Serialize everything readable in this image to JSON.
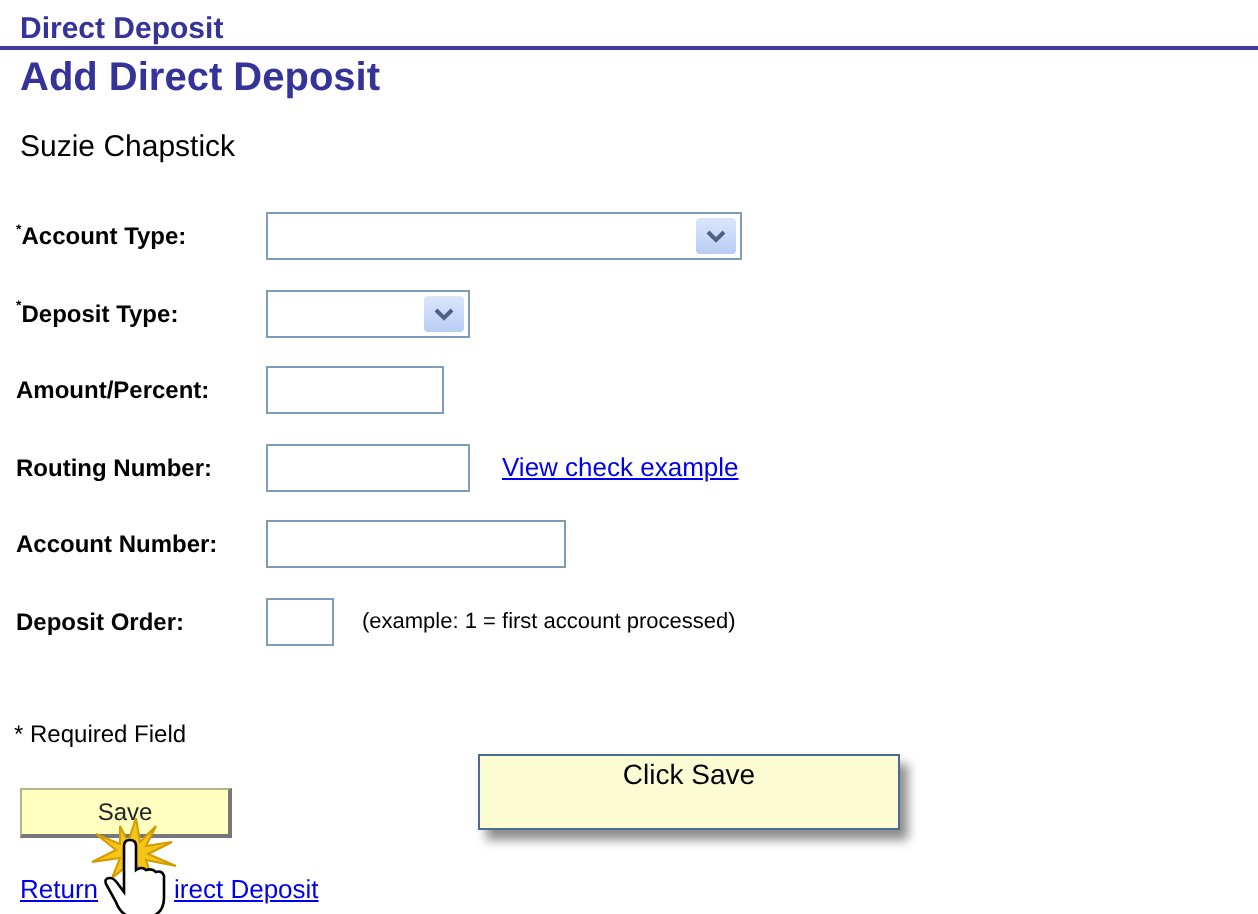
{
  "page": {
    "section_title": "Direct Deposit",
    "title": "Add Direct Deposit",
    "employee_name": "Suzie Chapstick"
  },
  "form": {
    "fields": [
      {
        "kind": "select",
        "label": "$^{*}$Account Type:"
      },
      {
        "kind": "select",
        "label": "$^{*}$Deposit Type:"
      },
      {
        "kind": "text",
        "label": "Amount/Percent:"
      },
      {
        "kind": "text",
        "label": "Routing Number:",
        "link": "View check example"
      },
      {
        "kind": "text",
        "label": "Account Number:"
      },
      {
        "kind": "text",
        "label": "Deposit Order:",
        "note": "(example: 1 = first account processed)"
      }
    ],
    "required_note": "* Required Field",
    "save_button": "Save"
  },
  "callout": {
    "text": "Click Save"
  },
  "return_link": {
    "visible_before_cursor": "Return",
    "visible_after_cursor": "irect Deposit"
  }
}
